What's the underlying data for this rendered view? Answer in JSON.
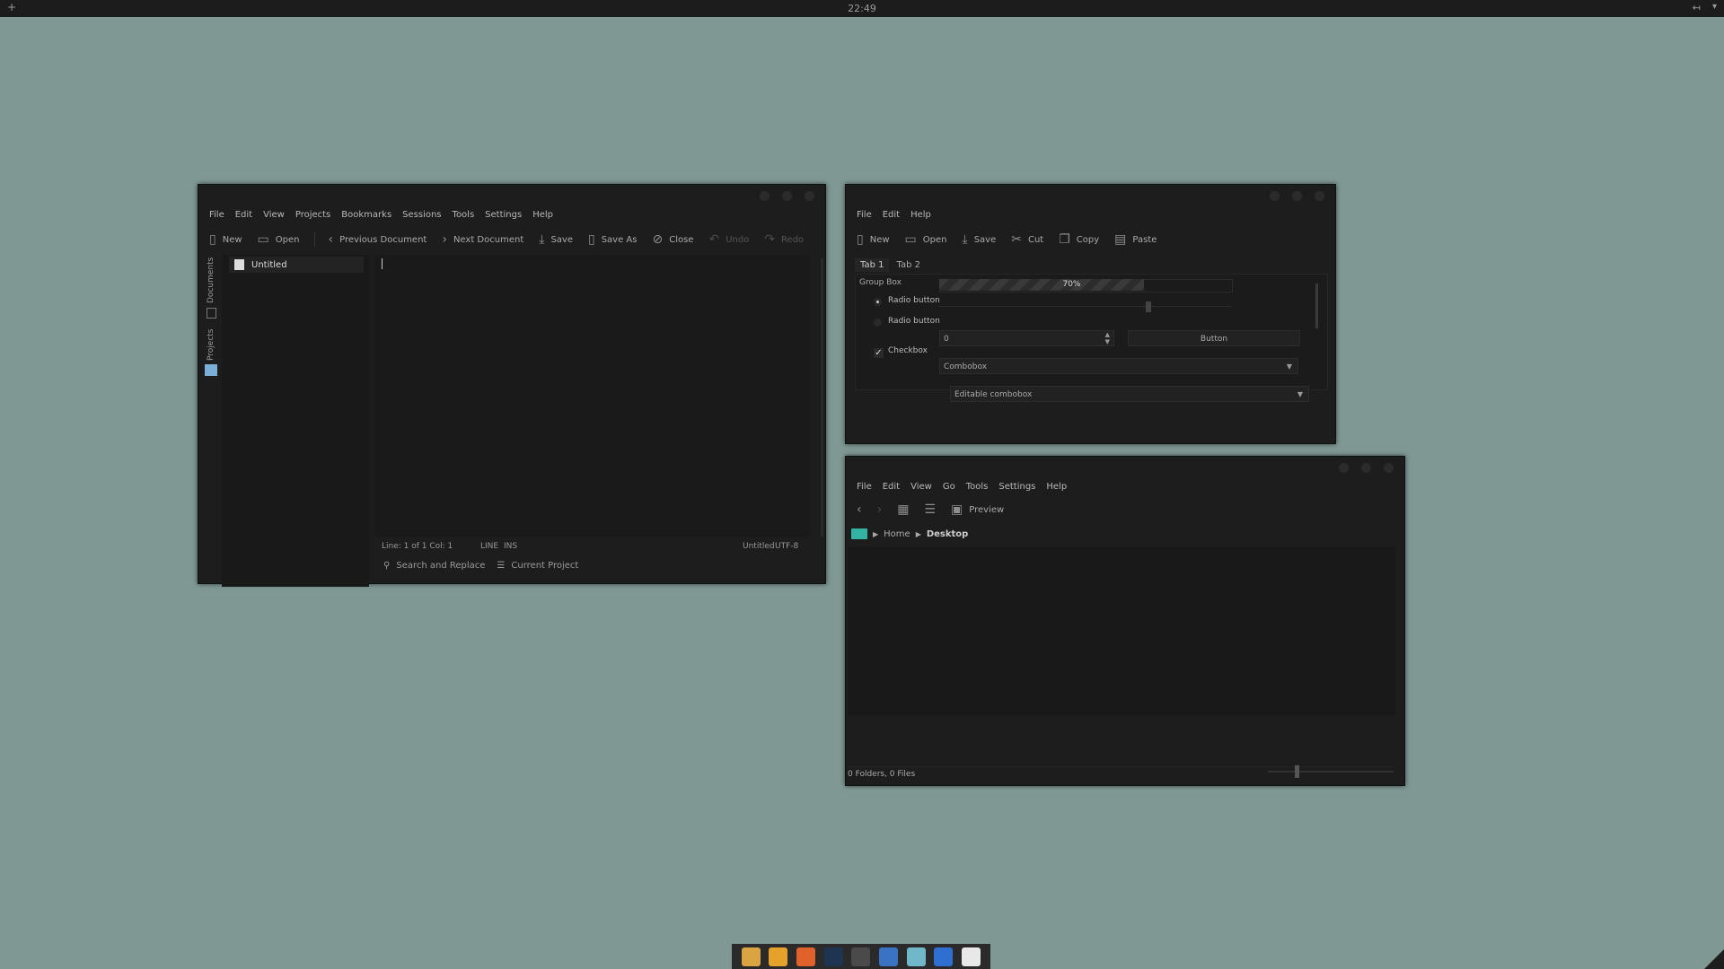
{
  "panel": {
    "clock": "22:49",
    "left_icon": "+",
    "right_icon1": "↤",
    "right_icon2": "▾"
  },
  "kate": {
    "menu": [
      "File",
      "Edit",
      "View",
      "Projects",
      "Bookmarks",
      "Sessions",
      "Tools",
      "Settings",
      "Help"
    ],
    "toolbar": {
      "new": "New",
      "open": "Open",
      "previous_document": "Previous Document",
      "next_document": "Next Document",
      "save": "Save",
      "save_as": "Save As",
      "close": "Close",
      "undo": "Undo",
      "redo": "Redo"
    },
    "side_tabs": {
      "documents": "Documents",
      "projects": "Projects"
    },
    "documents": [
      {
        "name": "Untitled"
      }
    ],
    "status": {
      "position": "Line: 1 of 1 Col: 1",
      "mode": "LINE",
      "insert": "INS",
      "filename": "Untitled",
      "encoding": "UTF-8"
    },
    "bottom_tabs": {
      "search": "Search and Replace",
      "project": "Current Project"
    }
  },
  "widgets": {
    "menu": [
      "File",
      "Edit",
      "Help"
    ],
    "toolbar": {
      "new": "New",
      "open": "Open",
      "save": "Save",
      "cut": "Cut",
      "copy": "Copy",
      "paste": "Paste"
    },
    "tabs": [
      "Tab 1",
      "Tab 2"
    ],
    "group_box": "Group Box",
    "progress": {
      "label": "70%",
      "value": 0.7
    },
    "radio1": "Radio button",
    "radio2": "Radio button",
    "checkbox": "Checkbox",
    "spin_value": "0",
    "button": "Button",
    "combobox": "Combobox",
    "editable_combobox": "Editable combobox"
  },
  "dolphin": {
    "menu": [
      "File",
      "Edit",
      "View",
      "Go",
      "Tools",
      "Settings",
      "Help"
    ],
    "toolbar": {
      "preview": "Preview"
    },
    "breadcrumb": {
      "home": "Home",
      "current": "Desktop"
    },
    "status": "0 Folders, 0 Files"
  },
  "dock": {
    "apps": [
      "tools-icon",
      "files-icon",
      "firefox-icon",
      "terminal-icon",
      "calculator-icon",
      "browser-icon",
      "image-viewer-icon",
      "office-icon",
      "text-editor-icon"
    ],
    "colors": [
      "#d9a441",
      "#e6a12b",
      "#e0622a",
      "#1e3552",
      "#4a4a4a",
      "#3a73c2",
      "#6fb7c9",
      "#2f6fd1",
      "#e8e8e8"
    ]
  }
}
